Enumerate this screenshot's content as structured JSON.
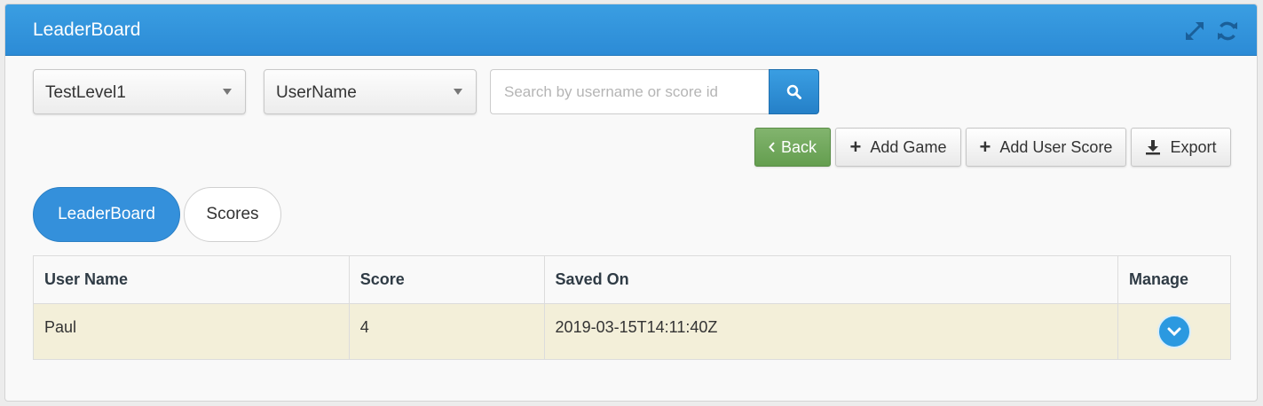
{
  "panel": {
    "title": "LeaderBoard"
  },
  "filters": {
    "level_select": "TestLevel1",
    "field_select": "UserName",
    "search_placeholder": "Search by username or score id"
  },
  "actions": {
    "back_label": "Back",
    "add_game_label": "Add Game",
    "add_user_score_label": "Add User Score",
    "export_label": "Export"
  },
  "tabs": {
    "leaderboard": "LeaderBoard",
    "scores": "Scores",
    "active": "LeaderBoard"
  },
  "table": {
    "headers": [
      "User Name",
      "Score",
      "Saved On",
      "Manage"
    ],
    "rows": [
      {
        "user_name": "Paul",
        "score": "4",
        "saved_on": "2019-03-15T14:11:40Z"
      }
    ]
  },
  "colors": {
    "accent": "#3490db",
    "back_button": "#6fa85a",
    "row_highlight": "#f3efd9"
  },
  "icons": {
    "header": [
      "expand-icon",
      "refresh-icon"
    ],
    "search": "search-icon",
    "back": "chevron-left-icon",
    "add": "plus-icon",
    "export": "download-icon",
    "manage": "chevron-down-icon"
  }
}
